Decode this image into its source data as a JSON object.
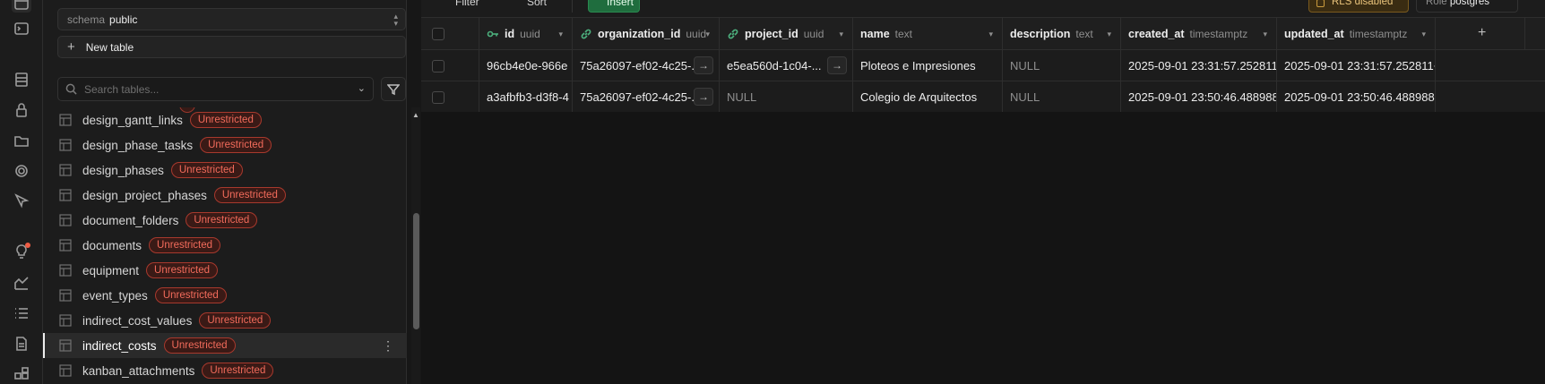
{
  "rail_icons": [
    "table-editor-icon",
    "sql-editor-icon",
    "database-icon",
    "auth-lock-icon",
    "storage-icon",
    "realtime-icon",
    "edge-functions-icon",
    "advisors-icon",
    "reports-icon",
    "logs-icon",
    "api-docs-icon",
    "integrations-icon"
  ],
  "sidebar": {
    "schema_label": "schema",
    "schema_value": "public",
    "new_table_label": "New table",
    "search_placeholder": "Search tables...",
    "tables": [
      {
        "name": "design_gantt_links",
        "badge": "Unrestricted"
      },
      {
        "name": "design_phase_tasks",
        "badge": "Unrestricted"
      },
      {
        "name": "design_phases",
        "badge": "Unrestricted"
      },
      {
        "name": "design_project_phases",
        "badge": "Unrestricted"
      },
      {
        "name": "document_folders",
        "badge": "Unrestricted"
      },
      {
        "name": "documents",
        "badge": "Unrestricted"
      },
      {
        "name": "equipment",
        "badge": "Unrestricted"
      },
      {
        "name": "event_types",
        "badge": "Unrestricted"
      },
      {
        "name": "indirect_cost_values",
        "badge": "Unrestricted"
      },
      {
        "name": "indirect_costs",
        "badge": "Unrestricted"
      },
      {
        "name": "kanban_attachments",
        "badge": "Unrestricted"
      }
    ],
    "active_table": "indirect_costs"
  },
  "toolbar": {
    "filter_label": "Filter",
    "sort_label": "Sort",
    "insert_label": "Insert",
    "rls_label": "RLS disabled",
    "role_label": "Role",
    "role_value": "postgres"
  },
  "grid": {
    "columns": [
      {
        "name": "id",
        "type": "uuid"
      },
      {
        "name": "organization_id",
        "type": "uuid"
      },
      {
        "name": "project_id",
        "type": "uuid"
      },
      {
        "name": "name",
        "type": "text"
      },
      {
        "name": "description",
        "type": "text"
      },
      {
        "name": "created_at",
        "type": "timestamptz"
      },
      {
        "name": "updated_at",
        "type": "timestamptz"
      }
    ],
    "rows": [
      {
        "id": "96cb4e0e-966e",
        "organization_id": "75a26097-ef02-4c25-...",
        "project_id": "e5ea560d-1c04-...",
        "name": "Ploteos e Impresiones",
        "description": "NULL",
        "created_at": "2025-09-01 23:31:57.252811+0",
        "updated_at": "2025-09-01 23:31:57.252811+0"
      },
      {
        "id": "a3afbfb3-d3f8-4",
        "organization_id": "75a26097-ef02-4c25-...",
        "project_id": "NULL",
        "name": "Colegio de Arquitectos",
        "description": "NULL",
        "created_at": "2025-09-01 23:50:46.488988",
        "updated_at": "2025-09-01 23:50:46.488988"
      }
    ]
  },
  "colors": {
    "badge": "#f26b5b",
    "insert": "#1f6d3e",
    "fk_icon": "#4caf7d"
  }
}
